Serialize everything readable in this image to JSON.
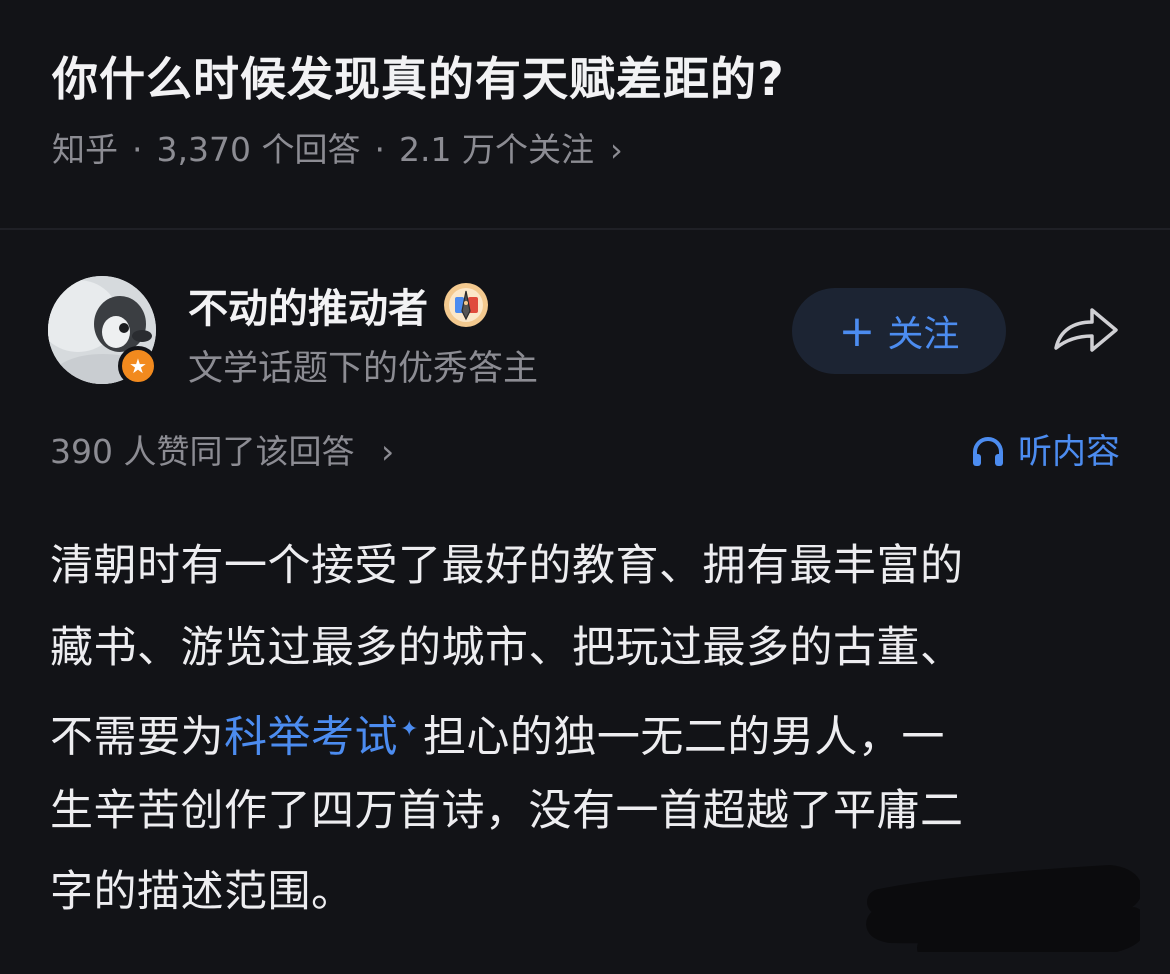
{
  "question": {
    "title": "你什么时候发现真的有天赋差距的?",
    "source": "知乎",
    "answers_count": "3,370 个回答",
    "followers_count": "2.1 万个关注",
    "sep": "·",
    "chevron": "›"
  },
  "author": {
    "name": "不动的推动者",
    "description": "文学话题下的优秀答主",
    "avatar_icon": "penguin-avatar-icon",
    "avatar_badge_icon": "star-badge-icon",
    "writer_badge_icon": "pen-badge-icon",
    "follow_plus": "+",
    "follow_label": "关注",
    "share_icon": "share-arrow-icon"
  },
  "votes": {
    "text": "390 人赞同了该回答",
    "chevron": "›"
  },
  "listen": {
    "icon": "headphones-icon",
    "label": "听内容"
  },
  "answer": {
    "lines": [
      "清朝时有一个接受了最好的教育、拥有最丰富的",
      "藏书、游览过最多的城市、把玩过最多的古董、",
      "不需要为",
      "科举考试",
      "担心的独一无二的男人，一",
      "生辛苦创作了四万首诗，没有一首超越了平庸二",
      "字的描述范围。"
    ],
    "spark": "✦"
  },
  "colors": {
    "background": "#121317",
    "text_primary": "#ededf0",
    "text_secondary": "#8c8c93",
    "accent_blue": "#4c8cf0",
    "follow_bg": "#1c2433",
    "badge_orange": "#f28a1e"
  }
}
